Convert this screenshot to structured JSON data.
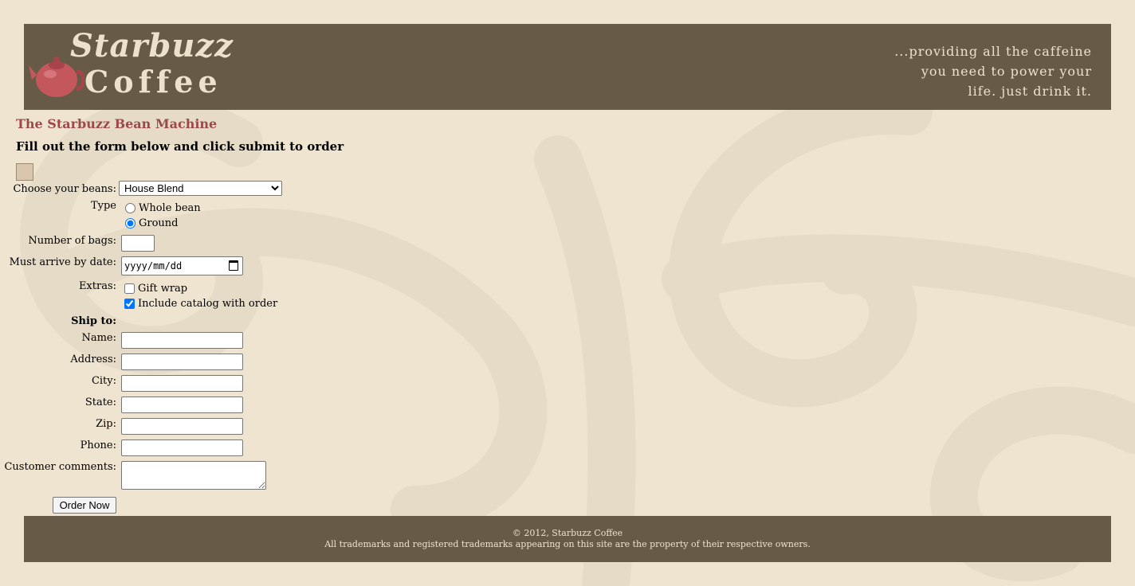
{
  "header": {
    "logo_line1": "Starbuzz",
    "logo_line2": "Coffee",
    "tagline": [
      "...providing all the caffeine",
      "you need to power your",
      "life. just drink it."
    ]
  },
  "page": {
    "title": "The Starbuzz Bean Machine",
    "subtitle": "Fill out the form below and click submit to order"
  },
  "form": {
    "beans_label": "Choose your beans:",
    "beans_selected": "House Blend",
    "type_label": "Type",
    "type_options": [
      "Whole bean",
      "Ground"
    ],
    "type_selected": "Ground",
    "bags_label": "Number of bags:",
    "date_label": "Must arrive by date:",
    "date_placeholder": "yyyy/mm/dd",
    "extras_label": "Extras:",
    "extras_options": [
      "Gift wrap",
      "Include catalog with order"
    ],
    "extras_checked": [
      "Include catalog with order"
    ],
    "ship_to_label": "Ship to:",
    "name_label": "Name:",
    "address_label": "Address:",
    "city_label": "City:",
    "state_label": "State:",
    "zip_label": "Zip:",
    "phone_label": "Phone:",
    "comments_label": "Customer comments:",
    "submit_label": "Order Now"
  },
  "footer": {
    "copyright": "© 2012, Starbuzz Coffee",
    "trademark": "All trademarks and registered trademarks appearing on this site are the property of their respective owners."
  },
  "colors": {
    "background": "#efe4d0",
    "header_bg": "#675b47",
    "title_color": "#9b4a4a",
    "header_text": "#ece2cc"
  }
}
